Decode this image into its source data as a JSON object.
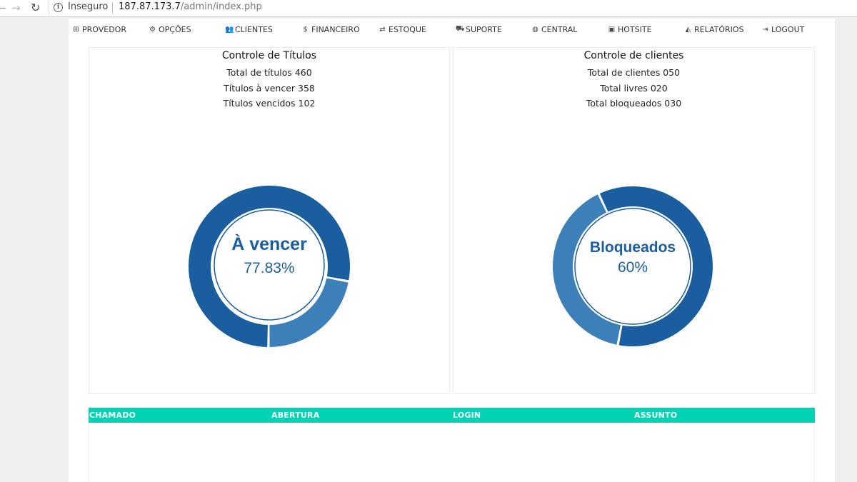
{
  "browser": {
    "back_glyph": "←",
    "forward_glyph": "→",
    "reload_glyph": "↻",
    "info_glyph": "i",
    "security_label": "Inseguro",
    "url_host": "187.87.173.7",
    "url_path": "/admin/index.php"
  },
  "menu": [
    {
      "label": "PROVEDOR",
      "icon": "sitemap-icon",
      "glyph": "⊞"
    },
    {
      "label": "OPÇÕES",
      "icon": "cogs-icon",
      "glyph": "⚙"
    },
    {
      "label": "CLIENTES",
      "icon": "users-icon",
      "glyph": "👥"
    },
    {
      "label": "FINANCEIRO",
      "icon": "dollar-icon",
      "glyph": "$"
    },
    {
      "label": "ESTOQUE",
      "icon": "exchange-icon",
      "glyph": "⇄"
    },
    {
      "label": "SUPORTE",
      "icon": "truck-icon",
      "glyph": "⛟"
    },
    {
      "label": "CENTRAL",
      "icon": "globe-icon",
      "glyph": "◍"
    },
    {
      "label": "HOTSITE",
      "icon": "html5-icon",
      "glyph": "▣"
    },
    {
      "label": "RELATÓRIOS",
      "icon": "area-chart-icon",
      "glyph": "◭"
    },
    {
      "label": "LOGOUT",
      "icon": "sign-out-icon",
      "glyph": "⇥"
    }
  ],
  "titles_panel": {
    "title": "Controle de Títulos",
    "stats": [
      "Total de títulos 460",
      "Títulos à vencer 358",
      "Títulos vencidos 102"
    ],
    "donut_label": "À vencer",
    "donut_value": "77.83%"
  },
  "clients_panel": {
    "title": "Controle de clientes",
    "stats": [
      "Total de clientes 050",
      "Total livres 020",
      "Total bloqueados 030"
    ],
    "donut_label": "Bloqueados",
    "donut_value": "60%"
  },
  "colors": {
    "primary_blue": "#1a5e9f",
    "secondary_blue": "#3d7fb8",
    "table_header": "#00d2b3"
  },
  "chart_data": [
    {
      "type": "pie",
      "categories": [
        "À vencer",
        "Vencidos"
      ],
      "values": [
        358,
        102
      ]
    },
    {
      "type": "pie",
      "categories": [
        "Bloqueados",
        "Livres"
      ],
      "values": [
        30,
        20
      ]
    }
  ],
  "table": {
    "headers": [
      "CHAMADO",
      "ABERTURA",
      "LOGIN",
      "ASSUNTO"
    ]
  }
}
